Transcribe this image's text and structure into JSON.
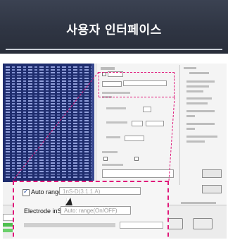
{
  "header": {
    "title": "사용자 인터페이스"
  },
  "zoom": {
    "auto_range_label": "Auto range",
    "range_value": "1nS-D(3.1.1.A)",
    "electrode_label": "Electrode inS",
    "electrode_value": "Auto: range(On/OFF)"
  },
  "colors": {
    "highlight": "#e0187a",
    "header_bg": "#2f3543",
    "data_panel": "#1f2d6e"
  },
  "icons": {
    "check": "check-icon",
    "cursor": "mouse-pointer-icon"
  }
}
